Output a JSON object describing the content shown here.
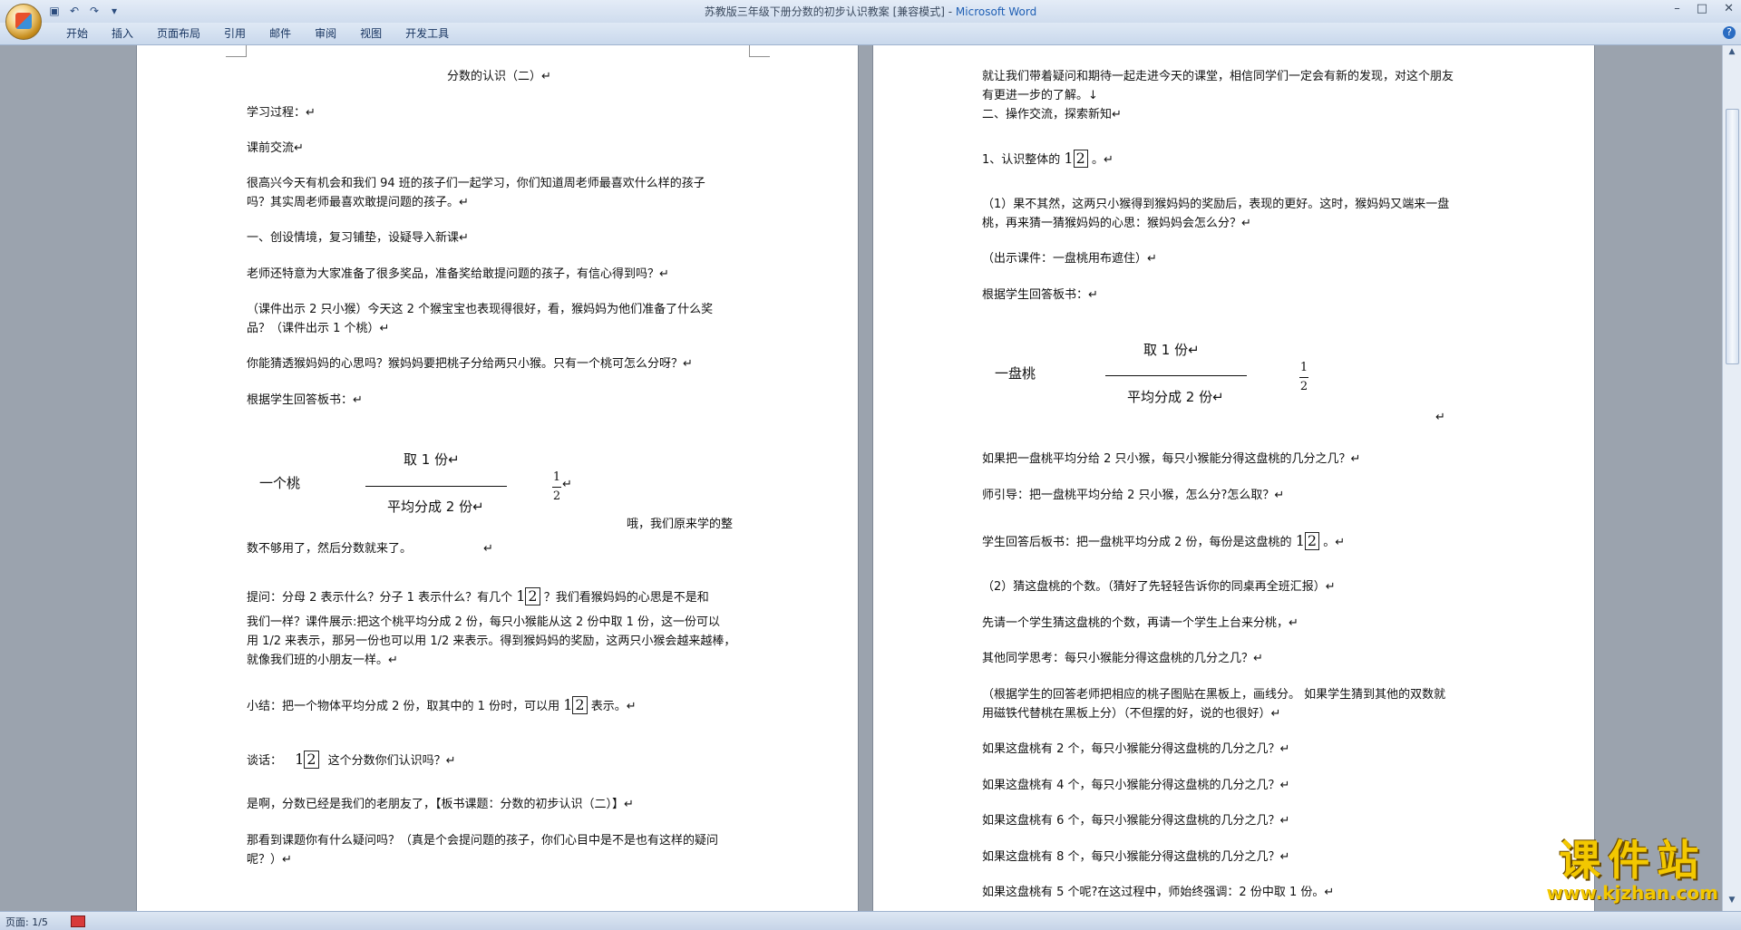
{
  "window": {
    "title_doc": "苏教版三年级下册分数的初步认识教案 [兼容模式] - ",
    "title_app": "Microsoft Word",
    "minimize": "–",
    "maximize": "□",
    "close": "✕"
  },
  "qat": {
    "save_icon": "save-icon",
    "undo": "↶",
    "redo": "↷",
    "more": "▾"
  },
  "ribbon": {
    "tabs": [
      "开始",
      "插入",
      "页面布局",
      "引用",
      "邮件",
      "审阅",
      "视图",
      "开发工具"
    ],
    "help": "?"
  },
  "left_page": {
    "title": "分数的认识（二）↵",
    "l1": "学习过程：↵",
    "l2": "课前交流↵",
    "l3a": "很高兴今天有机会和我们 94 班的孩子们一起学习，你们知道周老师最喜欢什么样的孩子",
    "l3b": "吗？其实周老师最喜欢敢提问题的孩子。↵",
    "l4": "一、创设情境，复习铺垫，设疑导入新课↵",
    "l5": "老师还特意为大家准备了很多奖品，准备奖给敢提问题的孩子，有信心得到吗？↵",
    "l6a": "（课件出示 2 只小猴）今天这 2 个猴宝宝也表现得很好，看，猴妈妈为他们准备了什么奖",
    "l6b": "品？（课件出示 1 个桃）↵",
    "l7": "你能猜透猴妈妈的心思吗？猴妈妈要把桃子分给两只小猴。只有一个桃可怎么分呀？↵",
    "l8": "根据学生回答板书：↵",
    "diag_left": "一个桃",
    "diag_top": "取 1 份↵",
    "diag_bottom": "平均分成 2 份↵",
    "frac_num": "1",
    "frac_den": "2",
    "frac_mark": "↵",
    "l9": "哦，我们原来学的整",
    "l10": "数不够用了，然后分数就来了。",
    "l10b": "↵",
    "l11a": "提问：分母 2 表示什么？分子 1 表示什么？有几个",
    "boxed": "2",
    "boxed_one": "1",
    "l11b": "？我们看猴妈妈的心思是不是和",
    "l12": "我们一样？课件展示:把这个桃平均分成 2 份，每只小猴能从这 2 份中取 1 份，这一份可以",
    "l13": "用 1/2 来表示，那另一份也可以用 1/2 来表示。得到猴妈妈的奖励，这两只小猴会越来越棒，",
    "l14": "就像我们班的小朋友一样。↵",
    "l15a": "小结：把一个物体平均分成 2 份，取其中的 1 份时，可以用",
    "l15b": "表示。↵",
    "l16a": "谈话：",
    "l16b": "这个分数你们认识吗？↵",
    "l17": "是啊，分数已经是我们的老朋友了，【板书课题：分数的初步认识（二）】↵",
    "l18a": "那看到课题你有什么疑问吗？（真是个会提问题的孩子，你们心目中是不是也有这样的疑问",
    "l18b": "呢？）↵"
  },
  "right_page": {
    "r1a": "就让我们带着疑问和期待一起走进今天的课堂，相信同学们一定会有新的发现，对这个朋友",
    "r1b": "有更进一步的了解。↓",
    "r2": "二、操作交流，探索新知↵",
    "r3a": "1、认识整体的",
    "r3b": "。↵",
    "r4a": "（1）果不其然，这两只小猴得到猴妈妈的奖励后，表现的更好。这时，猴妈妈又端来一盘",
    "r4b": "桃，再来猜一猜猴妈妈的心思：猴妈妈会怎么分？↵",
    "r5": "（出示课件：一盘桃用布遮住）↵",
    "r6": "根据学生回答板书：↵",
    "diag_left": "一盘桃",
    "diag_top": "取 1 份↵",
    "diag_bottom": "平均分成 2 份↵",
    "diag_mark": "↵",
    "r7": "如果把一盘桃平均分给 2 只小猴，每只小猴能分得这盘桃的几分之几？↵",
    "r8": "师引导：把一盘桃平均分给 2 只小猴，怎么分?怎么取？↵",
    "r9a": "学生回答后板书：把一盘桃平均分成 2 份，每份是这盘桃的",
    "r9b": "。↵",
    "r10": "（2）猜这盘桃的个数。（猜好了先轻轻告诉你的同桌再全班汇报）↵",
    "r11": "先请一个学生猜这盘桃的个数，再请一个学生上台来分桃，↵",
    "r12": "其他同学思考：每只小猴能分得这盘桃的几分之几？↵",
    "r13a": "（根据学生的回答老师把相应的桃子图贴在黑板上，画线分。 如果学生猜到其他的双数就",
    "r13b": "用磁铁代替桃在黑板上分）（不但摆的好，说的也很好）↵",
    "r14": "如果这盘桃有 2 个，每只小猴能分得这盘桃的几分之几？↵",
    "r15": "如果这盘桃有 4 个，每只小猴能分得这盘桃的几分之几？↵",
    "r16": "如果这盘桃有 6 个，每只小猴能分得这盘桃的几分之几？↵",
    "r17": "如果这盘桃有 8 个，每只小猴能分得这盘桃的几分之几？↵",
    "r18": "如果这盘桃有 5 个呢?在这过程中，师始终强调：2 份中取 1 份。↵"
  },
  "status": {
    "page": "页面: 1/5"
  },
  "watermark": {
    "cn": "课件站",
    "url": "www.kjzhan.com"
  }
}
